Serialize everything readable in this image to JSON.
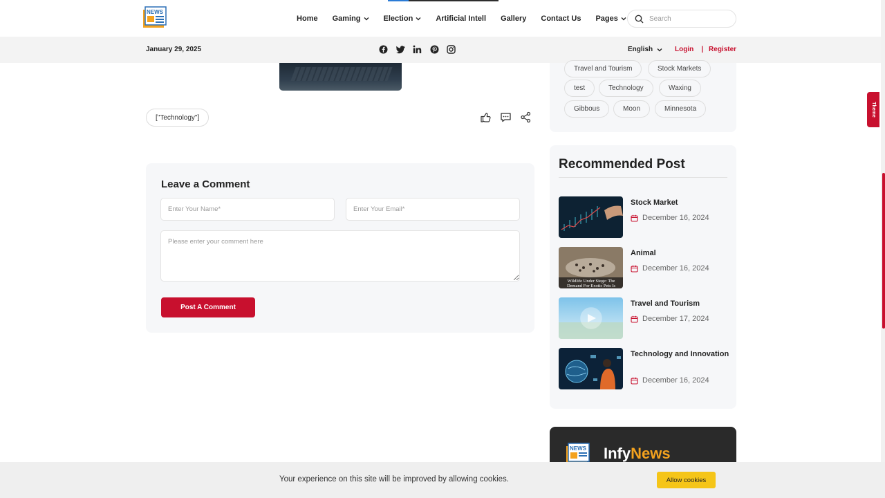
{
  "nav": {
    "items": [
      {
        "label": "Home",
        "dropdown": false
      },
      {
        "label": "Gaming",
        "dropdown": true
      },
      {
        "label": "Election",
        "dropdown": true
      },
      {
        "label": "Artificial Intell",
        "dropdown": false
      },
      {
        "label": "Gallery",
        "dropdown": false
      },
      {
        "label": "Contact Us",
        "dropdown": false
      },
      {
        "label": "Pages",
        "dropdown": true
      }
    ],
    "search_placeholder": "Search"
  },
  "infobar": {
    "date": "January 29, 2025",
    "socials": [
      "facebook-icon",
      "twitter-icon",
      "linkedin-icon",
      "pinterest-icon",
      "instagram-icon"
    ],
    "language": "English",
    "login": "Login",
    "separator": "|",
    "register": "Register"
  },
  "article": {
    "tag": "[\"Technology\"]",
    "actions": [
      "like-icon",
      "comment-icon",
      "share-icon"
    ]
  },
  "comment_form": {
    "title": "Leave a Comment",
    "name_placeholder": "Enter Your Name*",
    "email_placeholder": "Enter Your Email*",
    "comment_placeholder": "Please enter your comment here",
    "submit_label": "Post A Comment"
  },
  "sidebar": {
    "tags": [
      "Travel and Tourism",
      "Stock Markets",
      "test",
      "Technology",
      "Waxing",
      "Gibbous",
      "Moon",
      "Minnesota"
    ],
    "recommended_title": "Recommended Post",
    "recommended": [
      {
        "title": "Stock Market",
        "date": "December 16, 2024",
        "thumb_caption": ""
      },
      {
        "title": "Animal",
        "date": "December 16, 2024",
        "thumb_caption": "Wildlife Under Siege: The Demand For Exotic Pets Is"
      },
      {
        "title": "Travel and Tourism",
        "date": "December 17, 2024",
        "thumb_caption": ""
      },
      {
        "title": "Technology and Innovation",
        "date": "December 16, 2024",
        "thumb_caption": ""
      }
    ],
    "brand": {
      "name_part1": "Infy",
      "name_part2": "News"
    }
  },
  "theme_tab": "Theme",
  "cookie": {
    "text": "Your experience on this site will be improved by allowing cookies.",
    "button": "Allow cookies"
  },
  "colors": {
    "accent": "#c8102e",
    "cookie_button": "#f5c518",
    "card_bg": "#f6f7f9",
    "brand_orange": "#f4a21e"
  }
}
